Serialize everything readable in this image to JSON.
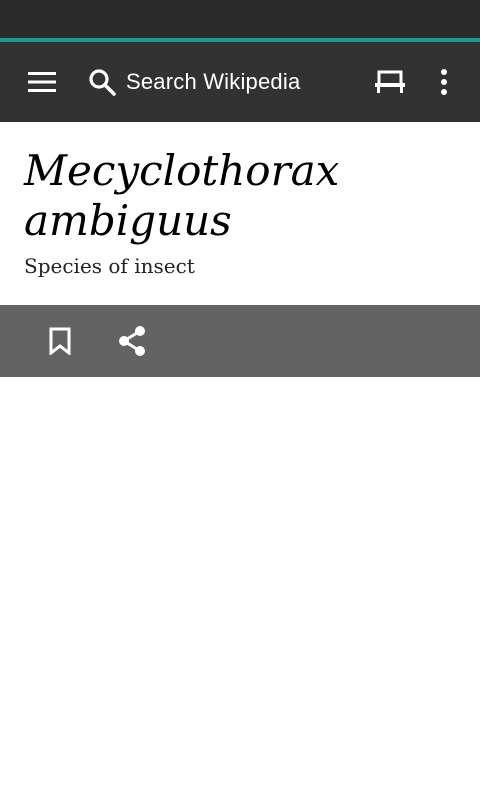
{
  "toolbar": {
    "search_placeholder": "Search Wikipedia",
    "icons": {
      "menu": "menu-icon",
      "search": "search-icon",
      "reading_list": "reading-list-icon",
      "overflow": "more-vert-icon"
    }
  },
  "article": {
    "title": "Mecyclothorax ambiguus",
    "description": "Species of insect"
  },
  "action_bar": {
    "icons": {
      "bookmark": "bookmark-icon",
      "share": "share-icon"
    }
  },
  "colors": {
    "status_bar": "#2b2b2b",
    "accent": "#1a9c8c",
    "toolbar": "#323232",
    "action_bar": "#636363"
  }
}
